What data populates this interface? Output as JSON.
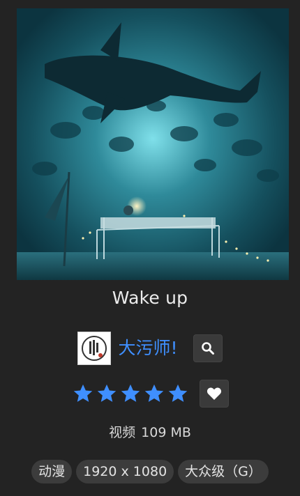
{
  "item": {
    "title": "Wake up",
    "author": "大污师!",
    "rating": 5,
    "rating_max": 5,
    "type": "视频",
    "size": "109 MB",
    "tags": [
      "动漫",
      "1920 x 1080",
      "大众级（G）"
    ]
  },
  "icons": {
    "search": "search-icon",
    "favorite": "heart-icon",
    "star": "star-icon"
  },
  "colors": {
    "accent": "#3f8fff",
    "background": "#232323",
    "button": "#3a3a3a"
  }
}
